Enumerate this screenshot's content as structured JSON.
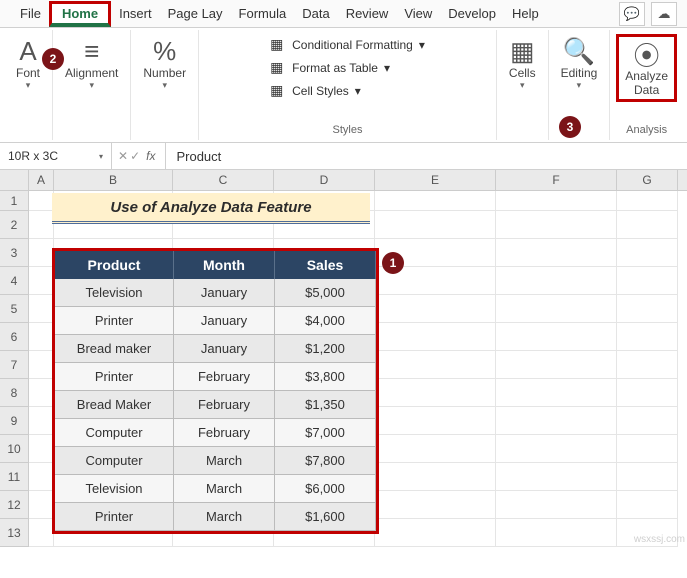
{
  "tabs": [
    "File",
    "Home",
    "Insert",
    "Page Lay",
    "Formula",
    "Data",
    "Review",
    "View",
    "Develop",
    "Help"
  ],
  "active_tab": "Home",
  "ribbon": {
    "font_label": "Font",
    "alignment_label": "Alignment",
    "number_label": "Number",
    "cond_fmt": "Conditional Formatting",
    "fmt_table": "Format as Table",
    "cell_styles": "Cell Styles",
    "styles_label": "Styles",
    "cells_label": "Cells",
    "editing_label": "Editing",
    "analyze_line1": "Analyze",
    "analyze_line2": "Data",
    "analysis_label": "Analysis"
  },
  "name_box": "10R x 3C",
  "formula_bar": "Product",
  "title_cell": "Use of Analyze Data Feature",
  "columns": [
    "A",
    "B",
    "C",
    "D",
    "E",
    "F",
    "G"
  ],
  "row_nums": [
    1,
    2,
    3,
    4,
    5,
    6,
    7,
    8,
    9,
    10,
    11,
    12,
    13
  ],
  "table": {
    "headers": [
      "Product",
      "Month",
      "Sales"
    ],
    "rows": [
      [
        "Television",
        "January",
        "$5,000"
      ],
      [
        "Printer",
        "January",
        "$4,000"
      ],
      [
        "Bread maker",
        "January",
        "$1,200"
      ],
      [
        "Printer",
        "February",
        "$3,800"
      ],
      [
        "Bread Maker",
        "February",
        "$1,350"
      ],
      [
        "Computer",
        "February",
        "$7,000"
      ],
      [
        "Computer",
        "March",
        "$7,800"
      ],
      [
        "Television",
        "March",
        "$6,000"
      ],
      [
        "Printer",
        "March",
        "$1,600"
      ]
    ]
  },
  "watermark": "wsxssj.com",
  "chart_data": {
    "type": "table",
    "title": "Use of Analyze Data Feature",
    "columns": [
      "Product",
      "Month",
      "Sales"
    ],
    "rows": [
      {
        "Product": "Television",
        "Month": "January",
        "Sales": 5000
      },
      {
        "Product": "Printer",
        "Month": "January",
        "Sales": 4000
      },
      {
        "Product": "Bread maker",
        "Month": "January",
        "Sales": 1200
      },
      {
        "Product": "Printer",
        "Month": "February",
        "Sales": 3800
      },
      {
        "Product": "Bread Maker",
        "Month": "February",
        "Sales": 1350
      },
      {
        "Product": "Computer",
        "Month": "February",
        "Sales": 7000
      },
      {
        "Product": "Computer",
        "Month": "March",
        "Sales": 7800
      },
      {
        "Product": "Television",
        "Month": "March",
        "Sales": 6000
      },
      {
        "Product": "Printer",
        "Month": "March",
        "Sales": 1600
      }
    ]
  }
}
